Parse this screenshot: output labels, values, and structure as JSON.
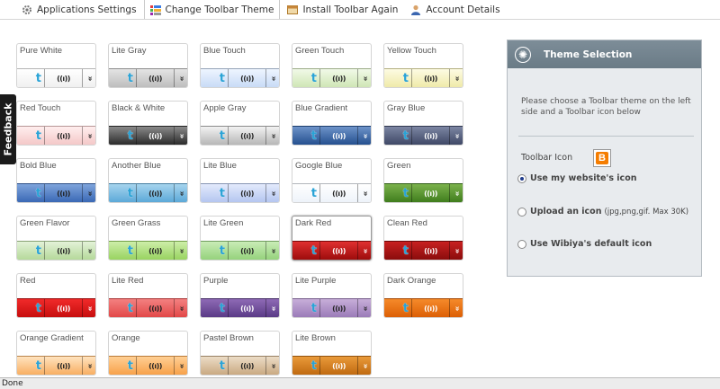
{
  "tabs": [
    {
      "label": "Applications Settings",
      "icon": "gear-icon",
      "active": false
    },
    {
      "label": "Change Toolbar Theme",
      "icon": "palette-icon",
      "active": true
    },
    {
      "label": "Install Toolbar Again",
      "icon": "toolbar-icon",
      "active": false
    },
    {
      "label": "Account Details",
      "icon": "user-icon",
      "active": false
    }
  ],
  "feedback_label": "Feedback",
  "themes": [
    {
      "name": "Pure White",
      "colors": [
        "#ffffff",
        "#f0f0f0"
      ],
      "chev_color": "#222",
      "sig_color": "#222"
    },
    {
      "name": "Lite Gray",
      "colors": [
        "#e4e4e4",
        "#bdbdbd"
      ],
      "chev_color": "#222",
      "sig_color": "#222"
    },
    {
      "name": "Blue Touch",
      "colors": [
        "#eef5ff",
        "#c8dbf6"
      ],
      "chev_color": "#222",
      "sig_color": "#222"
    },
    {
      "name": "Green Touch",
      "colors": [
        "#f1f9e8",
        "#cfe6b5"
      ],
      "chev_color": "#222",
      "sig_color": "#222"
    },
    {
      "name": "Yellow Touch",
      "colors": [
        "#fdfbe3",
        "#efeaa9"
      ],
      "chev_color": "#222",
      "sig_color": "#222"
    },
    {
      "name": "Red Touch",
      "colors": [
        "#ffeeee",
        "#f4c8c8"
      ],
      "chev_color": "#222",
      "sig_color": "#222"
    },
    {
      "name": "Black & White",
      "colors": [
        "#8a8a8a",
        "#2b2b2b"
      ],
      "chev_color": "#fff",
      "sig_color": "#fff"
    },
    {
      "name": "Apple Gray",
      "colors": [
        "#f2f2f2",
        "#b7b7b7"
      ],
      "chev_color": "#222",
      "sig_color": "#222"
    },
    {
      "name": "Blue Gradient",
      "colors": [
        "#6d93c9",
        "#25508f"
      ],
      "chev_color": "#fff",
      "sig_color": "#fff"
    },
    {
      "name": "Gray Blue",
      "colors": [
        "#7c86a3",
        "#3f4866"
      ],
      "chev_color": "#fff",
      "sig_color": "#fff"
    },
    {
      "name": "Bold Blue",
      "colors": [
        "#7fa4dc",
        "#3a68b5"
      ],
      "chev_color": "#222",
      "sig_color": "#222"
    },
    {
      "name": "Another Blue",
      "colors": [
        "#a6d4ee",
        "#5ca9d8"
      ],
      "chev_color": "#222",
      "sig_color": "#222"
    },
    {
      "name": "Lite Blue",
      "colors": [
        "#e3eafc",
        "#b4c6f0"
      ],
      "chev_color": "#222",
      "sig_color": "#222"
    },
    {
      "name": "Google Blue",
      "colors": [
        "#ffffff",
        "#eef3fa"
      ],
      "chev_color": "#222",
      "sig_color": "#222"
    },
    {
      "name": "Green",
      "colors": [
        "#7bb24c",
        "#3f7d1d"
      ],
      "chev_color": "#fff",
      "sig_color": "#fff"
    },
    {
      "name": "Green Flavor",
      "colors": [
        "#e3f2d8",
        "#b5d99a"
      ],
      "chev_color": "#222",
      "sig_color": "#222"
    },
    {
      "name": "Green Grass",
      "colors": [
        "#cdeea8",
        "#98d360"
      ],
      "chev_color": "#222",
      "sig_color": "#222"
    },
    {
      "name": "Lite Green",
      "colors": [
        "#c9ecb6",
        "#95d27c"
      ],
      "chev_color": "#222",
      "sig_color": "#222"
    },
    {
      "name": "Dark Red",
      "colors": [
        "#e03030",
        "#9d0c0c"
      ],
      "chev_color": "#fff",
      "sig_color": "#fff",
      "selected": true
    },
    {
      "name": "Clean Red",
      "colors": [
        "#c82121",
        "#8a0c0c"
      ],
      "chev_color": "#fff",
      "sig_color": "#fff"
    },
    {
      "name": "Red",
      "colors": [
        "#f02a2a",
        "#c70e0e"
      ],
      "chev_color": "#fff",
      "sig_color": "#fff"
    },
    {
      "name": "Lite Red",
      "colors": [
        "#f38080",
        "#e24848"
      ],
      "chev_color": "#222",
      "sig_color": "#222"
    },
    {
      "name": "Purple",
      "colors": [
        "#8e6ab5",
        "#5a3a86"
      ],
      "chev_color": "#fff",
      "sig_color": "#fff"
    },
    {
      "name": "Lite Purple",
      "colors": [
        "#c7aed9",
        "#9b7bb8"
      ],
      "chev_color": "#222",
      "sig_color": "#222"
    },
    {
      "name": "Dark Orange",
      "colors": [
        "#f58a2a",
        "#dc5f05"
      ],
      "chev_color": "#fff",
      "sig_color": "#fff"
    },
    {
      "name": "Orange Gradient",
      "colors": [
        "#ffe3bf",
        "#f8ae62"
      ],
      "chev_color": "#222",
      "sig_color": "#222"
    },
    {
      "name": "Orange",
      "colors": [
        "#ffcf94",
        "#f7a14a"
      ],
      "chev_color": "#222",
      "sig_color": "#222"
    },
    {
      "name": "Pastel Brown",
      "colors": [
        "#ecdcc6",
        "#c9a982"
      ],
      "chev_color": "#222",
      "sig_color": "#222"
    },
    {
      "name": "Lite Brown",
      "colors": [
        "#e99a3a",
        "#c06a10"
      ],
      "chev_color": "#fff",
      "sig_color": "#fff"
    }
  ],
  "toolbar_glyphs": {
    "bird": "t",
    "signal": "((ı))",
    "chevron": "»"
  },
  "panel": {
    "title": "Theme Selection",
    "description": "Please choose a Toolbar theme on the left side and a Toolbar icon below",
    "icon_label": "Toolbar Icon",
    "icon_letter": "B",
    "options": [
      {
        "label": "Use my website's icon",
        "note": "",
        "checked": true
      },
      {
        "label": "Upload an icon",
        "note": "(jpg,png,gif. Max 30K)",
        "checked": false
      },
      {
        "label": "Use Wibiya's default icon",
        "note": "",
        "checked": false
      }
    ]
  },
  "status_text": "Done"
}
